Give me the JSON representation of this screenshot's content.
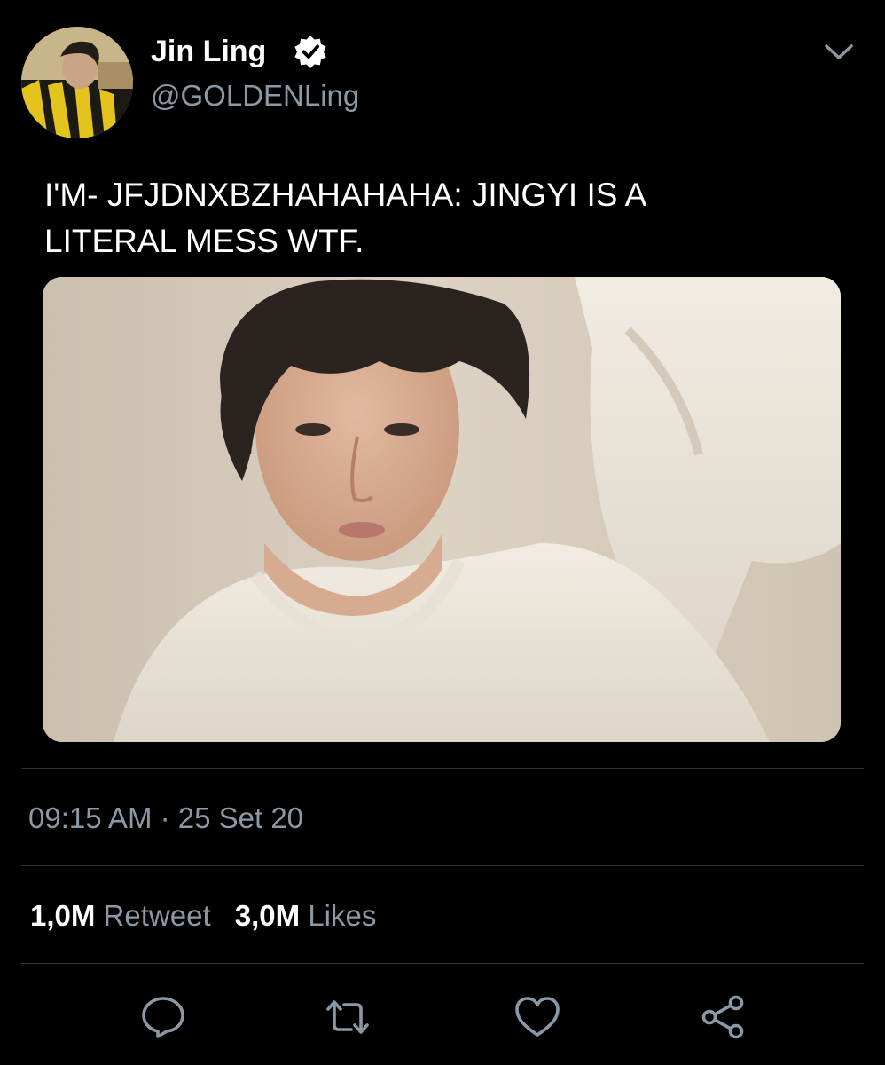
{
  "user": {
    "display_name": "Jin Ling",
    "handle": "@GOLDENLing",
    "verified": true
  },
  "tweet": {
    "text_line1": "I'M- JFJDNXBZHAHAHAHA: JINGYI IS A",
    "text_line2": "LITERAL MESS WTF.",
    "timestamp": "09:15 AM · 25 Set 20"
  },
  "stats": {
    "retweets_count": "1,0M",
    "retweets_label": "Retweet",
    "likes_count": "3,0M",
    "likes_label": "Likes"
  },
  "icons": {
    "verified": "verified-badge-icon",
    "caret": "chevron-down-icon",
    "reply": "reply-icon",
    "retweet": "retweet-icon",
    "like": "heart-icon",
    "share": "share-icon"
  },
  "colors": {
    "background": "#000000",
    "text": "#ffffff",
    "muted": "#8b98a5",
    "divider": "#2f3336"
  }
}
